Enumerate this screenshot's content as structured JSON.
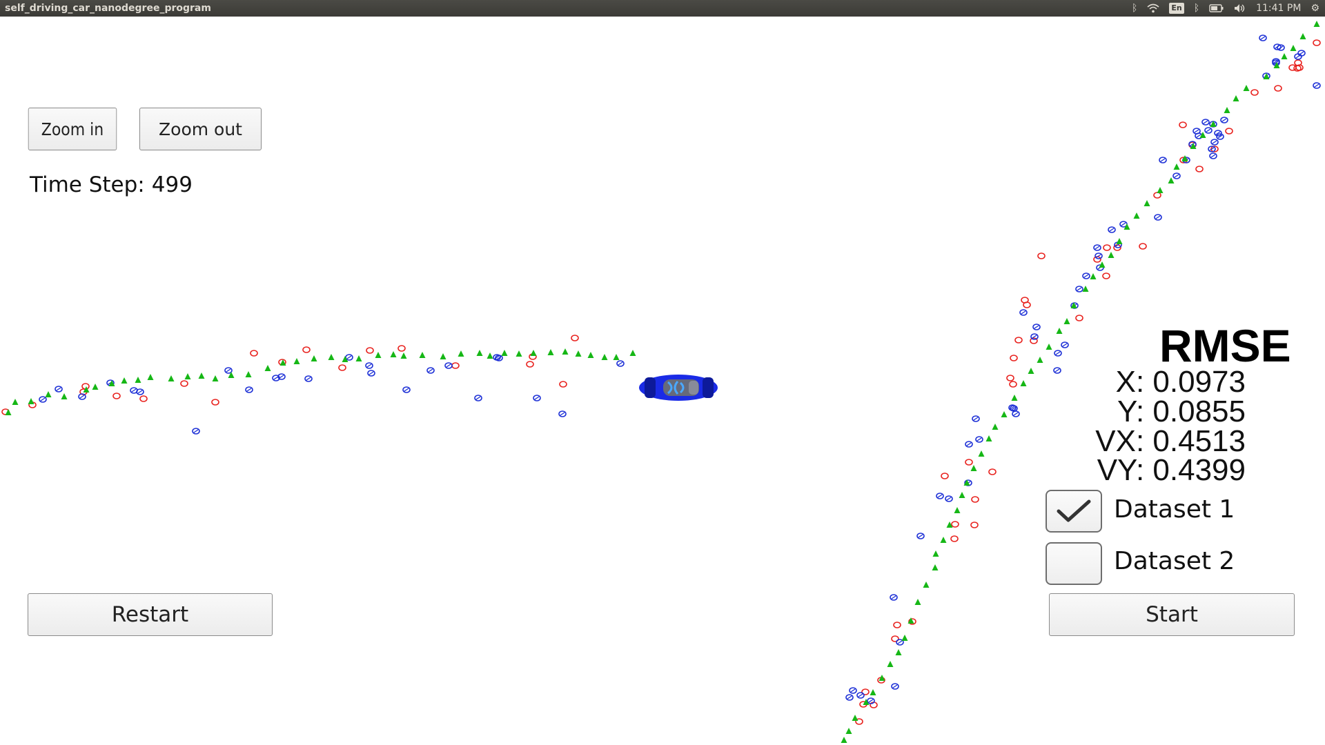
{
  "window": {
    "title": "self_driving_car_nanodegree_program"
  },
  "tray": {
    "keyboard_layout": "En",
    "clock": "11:41 PM",
    "icons": [
      "bluetooth-icon",
      "wifi-icon",
      "keyboard-icon",
      "bluetooth-icon",
      "battery-icon",
      "volume-icon",
      "settings-gear-icon"
    ]
  },
  "controls": {
    "zoom_in_label": "Zoom in",
    "zoom_out_label": "Zoom out",
    "restart_label": "Restart",
    "start_label": "Start"
  },
  "time_step": {
    "label": "Time Step:",
    "value": "499"
  },
  "rmse": {
    "title": "RMSE",
    "x": "X: 0.0973",
    "y": "Y: 0.0855",
    "vx": "VX: 0.4513",
    "vy": "VY: 0.4399"
  },
  "datasets": [
    {
      "label": "Dataset 1",
      "checked": true
    },
    {
      "label": "Dataset 2",
      "checked": false
    }
  ],
  "colors": {
    "lidar": "#e8211d",
    "radar": "#1c2fd6",
    "estimate": "#16b716",
    "car": "#1a2be6"
  },
  "markers": {
    "estimates": [
      [
        12,
        598
      ],
      [
        22,
        583
      ],
      [
        45,
        582
      ],
      [
        70,
        572
      ],
      [
        93,
        575
      ],
      [
        125,
        565
      ],
      [
        138,
        561
      ],
      [
        162,
        556
      ],
      [
        180,
        552
      ],
      [
        200,
        551
      ],
      [
        218,
        547
      ],
      [
        248,
        549
      ],
      [
        272,
        546
      ],
      [
        292,
        545
      ],
      [
        312,
        549
      ],
      [
        335,
        544
      ],
      [
        360,
        543
      ],
      [
        388,
        534
      ],
      [
        410,
        526
      ],
      [
        430,
        524
      ],
      [
        455,
        520
      ],
      [
        480,
        518
      ],
      [
        500,
        521
      ],
      [
        520,
        520
      ],
      [
        548,
        515
      ],
      [
        570,
        514
      ],
      [
        585,
        516
      ],
      [
        612,
        515
      ],
      [
        642,
        517
      ],
      [
        668,
        513
      ],
      [
        695,
        512
      ],
      [
        710,
        516
      ],
      [
        731,
        512
      ],
      [
        752,
        513
      ],
      [
        773,
        512
      ],
      [
        798,
        511
      ],
      [
        819,
        510
      ],
      [
        838,
        513
      ],
      [
        856,
        515
      ],
      [
        876,
        518
      ],
      [
        893,
        518
      ],
      [
        917,
        512
      ],
      [
        1223,
        1073
      ],
      [
        1230,
        1060
      ],
      [
        1239,
        1041
      ],
      [
        1255,
        1018
      ],
      [
        1265,
        1004
      ],
      [
        1278,
        983
      ],
      [
        1290,
        963
      ],
      [
        1302,
        946
      ],
      [
        1311,
        925
      ],
      [
        1320,
        900
      ],
      [
        1330,
        873
      ],
      [
        1342,
        848
      ],
      [
        1355,
        823
      ],
      [
        1356,
        803
      ],
      [
        1367,
        783
      ],
      [
        1376,
        761
      ],
      [
        1387,
        740
      ],
      [
        1394,
        718
      ],
      [
        1401,
        700
      ],
      [
        1411,
        679
      ],
      [
        1422,
        658
      ],
      [
        1433,
        636
      ],
      [
        1442,
        619
      ],
      [
        1455,
        601
      ],
      [
        1470,
        577
      ],
      [
        1483,
        556
      ],
      [
        1494,
        538
      ],
      [
        1507,
        522
      ],
      [
        1520,
        503
      ],
      [
        1535,
        480
      ],
      [
        1546,
        466
      ],
      [
        1556,
        443
      ],
      [
        1573,
        419
      ],
      [
        1584,
        401
      ],
      [
        1597,
        384
      ],
      [
        1610,
        370
      ],
      [
        1622,
        350
      ],
      [
        1633,
        329
      ],
      [
        1647,
        313
      ],
      [
        1662,
        295
      ],
      [
        1681,
        276
      ],
      [
        1697,
        262
      ],
      [
        1705,
        242
      ],
      [
        1717,
        230
      ],
      [
        1729,
        212
      ],
      [
        1743,
        196
      ],
      [
        1758,
        180
      ],
      [
        1778,
        160
      ],
      [
        1791,
        143
      ],
      [
        1806,
        128
      ],
      [
        1835,
        111
      ],
      [
        1850,
        95
      ],
      [
        1861,
        82
      ],
      [
        1874,
        70
      ],
      [
        1888,
        53
      ],
      [
        1908,
        35
      ]
    ],
    "lidar": [
      [
        8,
        597
      ],
      [
        47,
        587
      ],
      [
        121,
        568
      ],
      [
        124,
        560
      ],
      [
        169,
        574
      ],
      [
        208,
        578
      ],
      [
        267,
        556
      ],
      [
        312,
        583
      ],
      [
        368,
        512
      ],
      [
        409,
        525
      ],
      [
        444,
        507
      ],
      [
        496,
        533
      ],
      [
        536,
        508
      ],
      [
        582,
        505
      ],
      [
        660,
        530
      ],
      [
        768,
        528
      ],
      [
        772,
        517
      ],
      [
        816,
        557
      ],
      [
        833,
        490
      ],
      [
        1245,
        1046
      ],
      [
        1254,
        1003
      ],
      [
        1251,
        1021
      ],
      [
        1266,
        1022
      ],
      [
        1277,
        986
      ],
      [
        1300,
        906
      ],
      [
        1297,
        926
      ],
      [
        1322,
        901
      ],
      [
        1383,
        781
      ],
      [
        1384,
        760
      ],
      [
        1412,
        761
      ],
      [
        1413,
        724
      ],
      [
        1369,
        690
      ],
      [
        1404,
        670
      ],
      [
        1438,
        684
      ],
      [
        1464,
        548
      ],
      [
        1468,
        557
      ],
      [
        1469,
        519
      ],
      [
        1476,
        493
      ],
      [
        1488,
        442
      ],
      [
        1498,
        494
      ],
      [
        1485,
        435
      ],
      [
        1509,
        371
      ],
      [
        1564,
        461
      ],
      [
        1590,
        376
      ],
      [
        1603,
        400
      ],
      [
        1619,
        359
      ],
      [
        1604,
        359
      ],
      [
        1656,
        357
      ],
      [
        1677,
        283
      ],
      [
        1715,
        232
      ],
      [
        1728,
        210
      ],
      [
        1738,
        245
      ],
      [
        1714,
        181
      ],
      [
        1760,
        216
      ],
      [
        1781,
        190
      ],
      [
        1818,
        134
      ],
      [
        1852,
        128
      ],
      [
        1873,
        98
      ],
      [
        1908,
        62
      ],
      [
        1881,
        91
      ],
      [
        1880,
        99
      ],
      [
        1883,
        98
      ]
    ],
    "radar": [
      [
        62,
        579
      ],
      [
        85,
        564
      ],
      [
        119,
        575
      ],
      [
        160,
        555
      ],
      [
        194,
        566
      ],
      [
        203,
        568
      ],
      [
        284,
        625
      ],
      [
        331,
        537
      ],
      [
        361,
        565
      ],
      [
        400,
        548
      ],
      [
        408,
        546
      ],
      [
        447,
        549
      ],
      [
        506,
        518
      ],
      [
        535,
        530
      ],
      [
        538,
        541
      ],
      [
        589,
        565
      ],
      [
        624,
        537
      ],
      [
        650,
        530
      ],
      [
        693,
        577
      ],
      [
        778,
        577
      ],
      [
        815,
        600
      ],
      [
        723,
        519
      ],
      [
        899,
        527
      ],
      [
        720,
        518
      ],
      [
        1236,
        1001
      ],
      [
        1247,
        1008
      ],
      [
        1231,
        1011
      ],
      [
        1262,
        1016
      ],
      [
        1297,
        995
      ],
      [
        1304,
        931
      ],
      [
        1295,
        866
      ],
      [
        1334,
        777
      ],
      [
        1362,
        719
      ],
      [
        1375,
        723
      ],
      [
        1403,
        700
      ],
      [
        1419,
        637
      ],
      [
        1414,
        607
      ],
      [
        1467,
        591
      ],
      [
        1472,
        600
      ],
      [
        1404,
        644
      ],
      [
        1533,
        512
      ],
      [
        1469,
        592
      ],
      [
        1499,
        488
      ],
      [
        1483,
        453
      ],
      [
        1532,
        537
      ],
      [
        1543,
        500
      ],
      [
        1502,
        474
      ],
      [
        1557,
        443
      ],
      [
        1564,
        419
      ],
      [
        1574,
        400
      ],
      [
        1594,
        388
      ],
      [
        1592,
        371
      ],
      [
        1590,
        359
      ],
      [
        1620,
        355
      ],
      [
        1628,
        325
      ],
      [
        1611,
        333
      ],
      [
        1678,
        315
      ],
      [
        1685,
        232
      ],
      [
        1719,
        232
      ],
      [
        1705,
        255
      ],
      [
        1728,
        209
      ],
      [
        1737,
        197
      ],
      [
        1747,
        177
      ],
      [
        1760,
        206
      ],
      [
        1768,
        198
      ],
      [
        1756,
        216
      ],
      [
        1849,
        89
      ],
      [
        1835,
        110
      ],
      [
        1758,
        180
      ],
      [
        1765,
        193
      ],
      [
        1830,
        55
      ],
      [
        1849,
        91
      ],
      [
        1758,
        226
      ],
      [
        1734,
        190
      ],
      [
        1774,
        174
      ],
      [
        1751,
        189
      ],
      [
        1856,
        69
      ],
      [
        1881,
        82
      ],
      [
        1908,
        124
      ],
      [
        1851,
        68
      ],
      [
        1886,
        77
      ]
    ]
  }
}
